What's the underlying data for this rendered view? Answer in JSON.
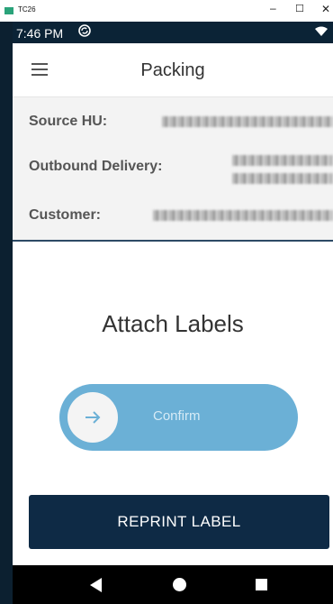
{
  "window": {
    "title": "TC26",
    "minimize": "–",
    "maximize": "☐",
    "close": "✕"
  },
  "status_bar": {
    "time": "7:46 PM",
    "sync_icon": "sync-icon",
    "wifi_icon": "wifi-icon"
  },
  "app_bar": {
    "title": "Packing",
    "menu_icon": "menu-icon"
  },
  "info": {
    "source_hu_label": "Source HU:",
    "outbound_delivery_label": "Outbound Delivery:",
    "customer_label": "Customer:"
  },
  "main": {
    "heading": "Attach Labels",
    "slider_label": "Confirm",
    "reprint_label": "REPRINT LABEL"
  },
  "colors": {
    "accent": "#6bb0d6",
    "button": "#0e2a45",
    "divider": "#2d4a66"
  }
}
